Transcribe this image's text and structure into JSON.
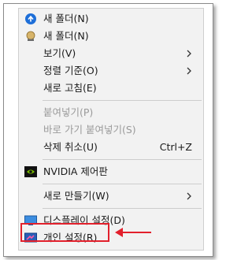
{
  "menu": {
    "items": [
      {
        "label": "새 폴더(N)",
        "icon": "refresh-blue-icon",
        "shortcut": "",
        "submenu": false,
        "disabled": false
      },
      {
        "label": "새 폴더(N)",
        "icon": "ball-icon",
        "shortcut": "",
        "submenu": false,
        "disabled": false
      },
      {
        "label": "보기(V)",
        "icon": "",
        "shortcut": "",
        "submenu": true,
        "disabled": false
      },
      {
        "label": "정렬 기준(O)",
        "icon": "",
        "shortcut": "",
        "submenu": true,
        "disabled": false
      },
      {
        "label": "새로 고침(E)",
        "icon": "",
        "shortcut": "",
        "submenu": false,
        "disabled": false
      },
      {
        "label": "붙여넣기(P)",
        "icon": "",
        "shortcut": "",
        "submenu": false,
        "disabled": true
      },
      {
        "label": "바로 가기 붙여넣기(S)",
        "icon": "",
        "shortcut": "",
        "submenu": false,
        "disabled": true
      },
      {
        "label": "삭제 취소(U)",
        "icon": "",
        "shortcut": "Ctrl+Z",
        "submenu": false,
        "disabled": false
      },
      {
        "label": "NVIDIA 제어판",
        "icon": "nvidia-icon",
        "shortcut": "",
        "submenu": false,
        "disabled": false
      },
      {
        "label": "새로 만들기(W)",
        "icon": "",
        "shortcut": "",
        "submenu": true,
        "disabled": false
      },
      {
        "label": "디스플레이 설정(D)",
        "icon": "display-icon",
        "shortcut": "",
        "submenu": false,
        "disabled": false
      },
      {
        "label": "개인 설정(R)",
        "icon": "personalize-icon",
        "shortcut": "",
        "submenu": false,
        "disabled": false
      }
    ]
  },
  "colors": {
    "highlight": "#e2202c",
    "menu_bg": "#f2f2f2",
    "disabled_text": "#9a9a9a"
  }
}
